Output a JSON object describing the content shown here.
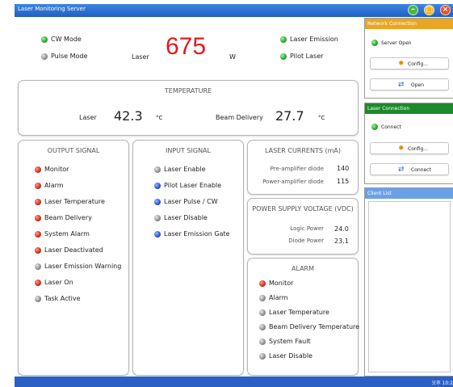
{
  "window": {
    "title": "Laser Monitoring Server"
  },
  "power": {
    "cw_mode": "CW Mode",
    "pulse_mode": "Pulse Mode",
    "label": "Laser",
    "value": "675",
    "unit": "W",
    "laser_emission": "Laser Emission",
    "pilot_laser": "Pilot Laser"
  },
  "temperature": {
    "title": "TEMPERATURE",
    "laser_label": "Laser",
    "laser_value": "42.3",
    "laser_unit": "°C",
    "beam_label": "Beam Delivery",
    "beam_value": "27.7",
    "beam_unit": "°C"
  },
  "output_signal": {
    "title": "OUTPUT SIGNAL",
    "items": [
      {
        "label": "Monitor",
        "state": "red"
      },
      {
        "label": "Alarm",
        "state": "red"
      },
      {
        "label": "Laser Temperature",
        "state": "red"
      },
      {
        "label": "Beam Delivery",
        "state": "red"
      },
      {
        "label": "System Alarm",
        "state": "red"
      },
      {
        "label": "Laser Deactivated",
        "state": "red"
      },
      {
        "label": "Laser Emission Warning",
        "state": "gray"
      },
      {
        "label": "Laser On",
        "state": "red"
      },
      {
        "label": "Task Active",
        "state": "gray"
      }
    ]
  },
  "input_signal": {
    "title": "INPUT SIGNAL",
    "items": [
      {
        "label": "Laser Enable",
        "state": "gray"
      },
      {
        "label": "Pilot Laser Enable",
        "state": "blue"
      },
      {
        "label": "Laser Pulse / CW",
        "state": "blue"
      },
      {
        "label": "Laser Disable",
        "state": "gray"
      },
      {
        "label": "Laser Emission Gate",
        "state": "blue"
      }
    ]
  },
  "laser_currents": {
    "title": "LASER CURRENTS (mA)",
    "pre_label": "Pre-amplifier diode",
    "pre_value": "140",
    "power_label": "Power-amplifier diode",
    "power_value": "115"
  },
  "power_supply": {
    "title": "POWER SUPPLY VOLTAGE (VDC)",
    "logic_label": "Logic Power",
    "logic_value": "24.0",
    "diode_label": "Diode Power",
    "diode_value": "23.1"
  },
  "alarm": {
    "title": "ALARM",
    "items": [
      {
        "label": "Monitor",
        "state": "red"
      },
      {
        "label": "Alarm",
        "state": "gray"
      },
      {
        "label": "Laser Temperature",
        "state": "gray"
      },
      {
        "label": "Beam Delivery Temperature",
        "state": "gray"
      },
      {
        "label": "System Fault",
        "state": "gray"
      },
      {
        "label": "Laser Disable",
        "state": "gray"
      }
    ]
  },
  "network_connection": {
    "title": "Network Connection",
    "status": "Server Open",
    "config_label": "Config...",
    "open_label": "Open"
  },
  "laser_connection": {
    "title": "Laser Connection",
    "status": "Connect",
    "config_label": "Config...",
    "connect_label": "Connect"
  },
  "client_list": {
    "title": "Client List"
  },
  "statusbar": {
    "text": "오후 10:2"
  },
  "colors": {
    "accent": "#1f5fc4",
    "value_red": "#e01b1b",
    "network_header": "#e9a624",
    "laser_header": "#1c8a2a",
    "client_header": "#6aa0e8"
  },
  "icons": {
    "config": "gear-icon",
    "open": "refresh-arrows-icon",
    "minimize": "minimize-icon",
    "maximize": "maximize-icon",
    "close": "close-icon"
  }
}
